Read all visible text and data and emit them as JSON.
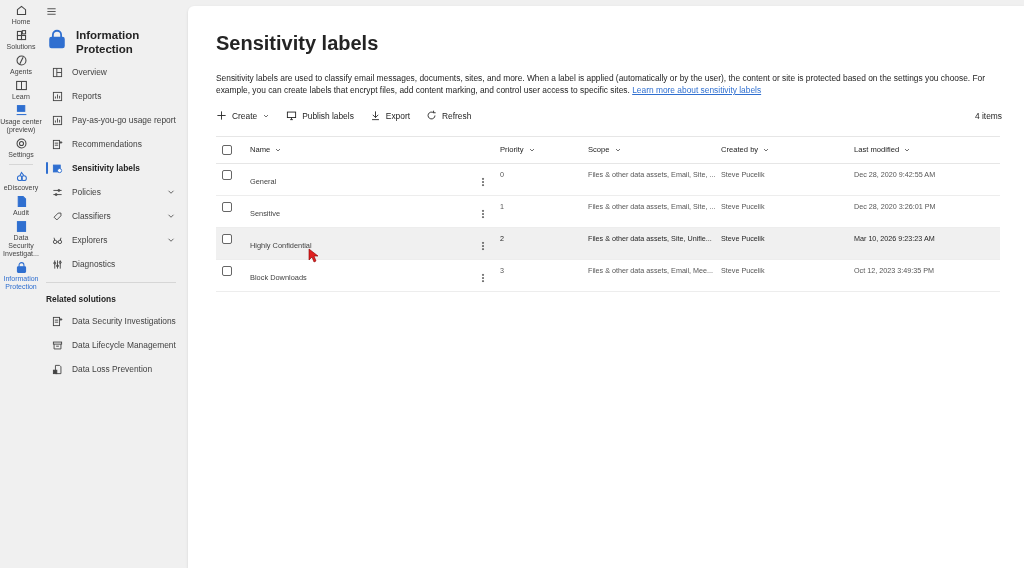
{
  "rail": [
    {
      "label": "Home",
      "selected": false
    },
    {
      "label": "Solutions",
      "selected": false
    },
    {
      "label": "Agents",
      "selected": false
    },
    {
      "label": "Learn",
      "selected": false
    },
    {
      "label": "Usage center (preview)",
      "selected": false
    },
    {
      "label": "Settings",
      "selected": false
    },
    {
      "label": "eDiscovery",
      "selected": false
    },
    {
      "label": "Audit",
      "selected": false
    },
    {
      "label": "Data Security Investigat...",
      "selected": false
    },
    {
      "label": "Information Protection",
      "selected": true
    }
  ],
  "nav": {
    "title": "Information Protection",
    "items": [
      {
        "label": "Overview",
        "selected": false,
        "expandable": false
      },
      {
        "label": "Reports",
        "selected": false,
        "expandable": false
      },
      {
        "label": "Pay-as-you-go usage report",
        "selected": false,
        "expandable": false
      },
      {
        "label": "Recommendations",
        "selected": false,
        "expandable": false
      },
      {
        "label": "Sensitivity labels",
        "selected": true,
        "expandable": false
      },
      {
        "label": "Policies",
        "selected": false,
        "expandable": true
      },
      {
        "label": "Classifiers",
        "selected": false,
        "expandable": true
      },
      {
        "label": "Explorers",
        "selected": false,
        "expandable": true
      },
      {
        "label": "Diagnostics",
        "selected": false,
        "expandable": false
      }
    ],
    "related_heading": "Related solutions",
    "related": [
      {
        "label": "Data Security Investigations"
      },
      {
        "label": "Data Lifecycle Management"
      },
      {
        "label": "Data Loss Prevention"
      }
    ]
  },
  "page": {
    "title": "Sensitivity labels",
    "description": "Sensitivity labels are used to classify email messages, documents, sites, and more. When a label is applied (automatically or by the user), the content or site is protected based on the settings you choose. For example, you can create labels that encrypt files, add content marking, and control user access to specific sites.",
    "link": "Learn more about sensitivity labels",
    "toolbar": [
      {
        "label": "Create",
        "dropdown": true
      },
      {
        "label": "Publish labels",
        "dropdown": false
      },
      {
        "label": "Export",
        "dropdown": false
      },
      {
        "label": "Refresh",
        "dropdown": false
      }
    ],
    "count": "4 items"
  },
  "table": {
    "header_checked": false,
    "columns": [
      "Name",
      "Priority",
      "Scope",
      "Created by",
      "Last modified"
    ],
    "rows": [
      {
        "name": "General",
        "priority": "0",
        "scope": "Files & other data assets, Email, Site, ...",
        "created_by": "Steve Pucelik",
        "modified": "Dec 28, 2020 9:42:55 AM",
        "highlighted": false,
        "checked": false
      },
      {
        "name": "Sensitive",
        "priority": "1",
        "scope": "Files & other data assets, Email, Site, ...",
        "created_by": "Steve Pucelik",
        "modified": "Dec 28, 2020 3:26:01 PM",
        "highlighted": false,
        "checked": false
      },
      {
        "name": "Highly Confidential",
        "priority": "2",
        "scope": "Files & other data assets, Site, Unifie...",
        "created_by": "Steve Pucelik",
        "modified": "Mar 10, 2026 9:23:23 AM",
        "highlighted": true,
        "checked": false
      },
      {
        "name": "Block Downloads",
        "priority": "3",
        "scope": "Files & other data assets, Email, Mee...",
        "created_by": "Steve Pucelik",
        "modified": "Oct 12, 2023 3:49:35 PM",
        "highlighted": false,
        "checked": false
      }
    ]
  }
}
